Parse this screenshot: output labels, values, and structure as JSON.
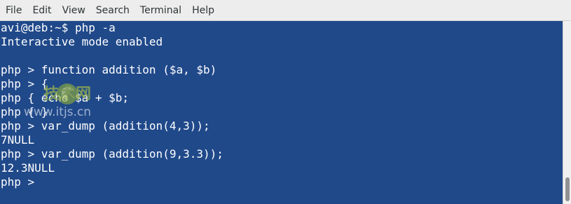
{
  "menubar": {
    "items": [
      "File",
      "Edit",
      "View",
      "Search",
      "Terminal",
      "Help"
    ]
  },
  "terminal": {
    "lines": [
      "avi@deb:~$ php -a",
      "Interactive mode enabled",
      "",
      "php > function addition ($a, $b)",
      "php > {",
      "php { echo $a + $b;",
      "php { }",
      "php > var_dump (addition(4,3));",
      "7NULL",
      "php > var_dump (addition(9,3.3));",
      "12.3NULL",
      "php > "
    ],
    "background": "#20498a",
    "foreground": "#ffffff"
  },
  "watermark": {
    "cn_text": "技术网",
    "url": "www.itjs.cn"
  }
}
